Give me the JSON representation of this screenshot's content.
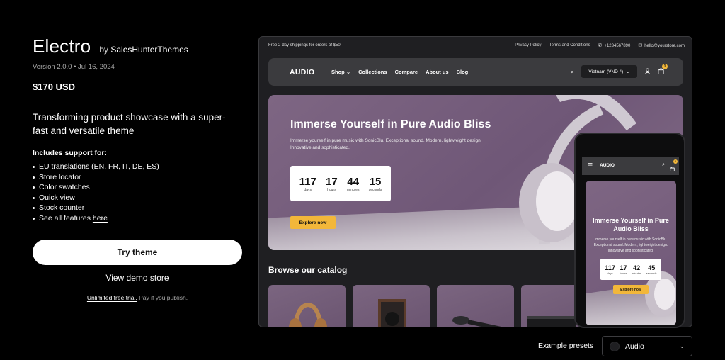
{
  "theme": {
    "name": "Electro",
    "by_prefix": "by",
    "author": "SalesHunterThemes",
    "meta": "Version 2.0.0 • Jul 16, 2024",
    "price": "$170 USD",
    "tagline": "Transforming product showcase with a super-fast and versatile theme",
    "support_title": "Includes support for:",
    "features": [
      "EU translations (EN, FR, IT, DE, ES)",
      "Store locator",
      "Color swatches",
      "Quick view",
      "Stock counter"
    ],
    "see_all_prefix": "See all features",
    "see_all_link": "here",
    "try_label": "Try theme",
    "demo_label": "View demo store",
    "trial_link": "Unlimited free trial.",
    "trial_suffix": "Pay if you publish."
  },
  "preview": {
    "topbar": {
      "promo": "Free 2-day shippings for orders of $50",
      "privacy": "Privacy Policy",
      "terms": "Terms and Conditions",
      "phone": "+1234567890",
      "email": "hello@yourstore.com"
    },
    "logo": "AUDIO",
    "nav": [
      "Shop",
      "Collections",
      "Compare",
      "About us",
      "Blog"
    ],
    "region": "Vietnam (VND ₫)",
    "cart_count": "1",
    "hero": {
      "title": "Immerse Yourself in Pure Audio Bliss",
      "text": "Immerse yourself in pure music with SonicBlu. Exceptional sound. Modern, lightweight design. Innovative and sophisticated.",
      "countdown": [
        {
          "value": "117",
          "label": "days"
        },
        {
          "value": "17",
          "label": "hours"
        },
        {
          "value": "44",
          "label": "minutes"
        },
        {
          "value": "15",
          "label": "seconds"
        }
      ],
      "cta": "Explore now"
    },
    "catalog_title": "Browse our catalog"
  },
  "phone": {
    "logo": "AUDIO",
    "cart_count": "1",
    "title": "Immerse Yourself in Pure Audio Bliss",
    "text": "Immerse yourself in pure music with SonicBlu. Exceptional sound. Modern, lightweight design. Innovative and sophisticated.",
    "countdown": [
      {
        "value": "117",
        "label": "days"
      },
      {
        "value": "17",
        "label": "hours"
      },
      {
        "value": "42",
        "label": "minutes"
      },
      {
        "value": "45",
        "label": "seconds"
      }
    ],
    "cta": "Explore now"
  },
  "presets": {
    "label": "Example presets",
    "selected": "Audio"
  },
  "colors": {
    "accent": "#f2b73a",
    "hero_bg": "#7e6683",
    "page_bg": "#000000"
  }
}
